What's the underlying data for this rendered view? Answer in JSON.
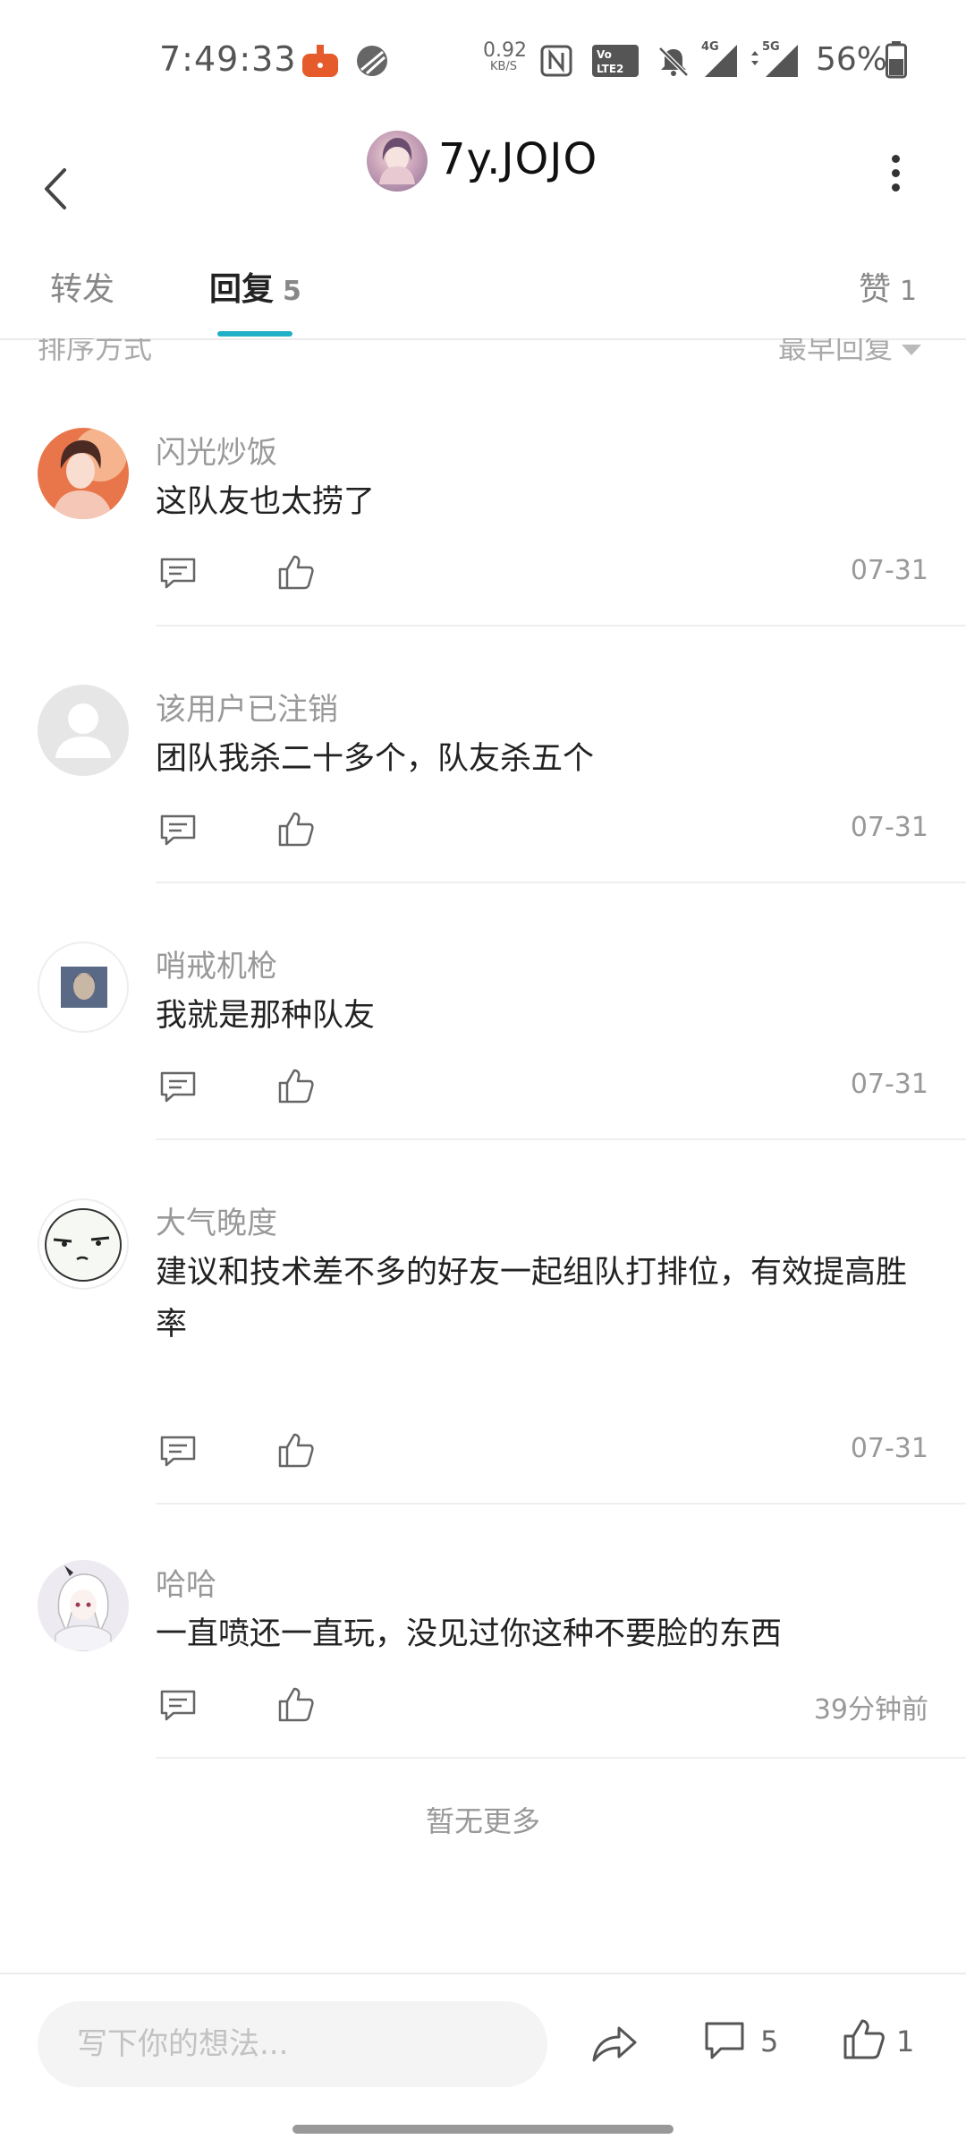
{
  "status_bar": {
    "time": "7:49:33",
    "speed_value": "0.92",
    "speed_unit": "KB/S",
    "network_4g": "4G",
    "network_5g": "5G",
    "battery": "56%",
    "icons": [
      "app-notification-icon",
      "blocked-icon",
      "nfc-icon",
      "volte-icon",
      "mute-icon",
      "signal-4g-icon",
      "signal-5g-icon",
      "battery-icon"
    ]
  },
  "header": {
    "title": "7y.JOJO"
  },
  "tabs": [
    {
      "label": "转发",
      "count": ""
    },
    {
      "label": "回复",
      "count": "5"
    },
    {
      "label": "赞",
      "count": "1"
    }
  ],
  "sort": {
    "label": "排序方式",
    "value": "最早回复"
  },
  "comments": [
    {
      "name": "闪光炒饭",
      "text": "这队友也太捞了",
      "date": "07-31"
    },
    {
      "name": "该用户已注销",
      "text": "团队我杀二十多个，队友杀五个",
      "date": "07-31"
    },
    {
      "name": "哨戒机枪",
      "text": "我就是那种队友",
      "date": "07-31"
    },
    {
      "name": "大气晚度",
      "text": "建议和技术差不多的好友一起组队打排位，有效提高胜率",
      "date": "07-31"
    },
    {
      "name": "哈哈",
      "text": "一直喷还一直玩，没见过你这种不要脸的东西",
      "date": "39分钟前"
    }
  ],
  "footer_note": "暂无更多",
  "bottom_bar": {
    "input_placeholder": "写下你的想法...",
    "comment_count": "5",
    "like_count": "1"
  },
  "colors": {
    "accent": "#22b0c8",
    "text_primary": "#222222",
    "text_secondary": "#999999"
  }
}
